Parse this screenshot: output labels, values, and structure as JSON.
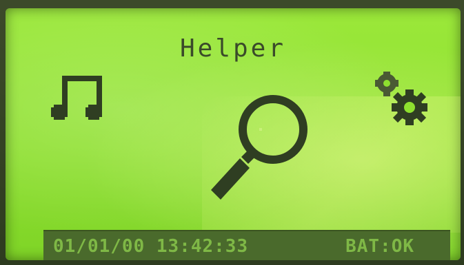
{
  "screen": {
    "title": "Helper"
  },
  "icons": {
    "left": "music-note-icon",
    "center": "search-icon",
    "right": "gears-icon"
  },
  "status_bar": {
    "datetime": "01/01/00 13:42:33",
    "battery": "BAT:OK"
  },
  "colors": {
    "lcd_background": "#8ee02f",
    "pixel_dark": "#2f3e22",
    "status_bar": "#4a6a2c",
    "status_text": "#7fb846"
  }
}
